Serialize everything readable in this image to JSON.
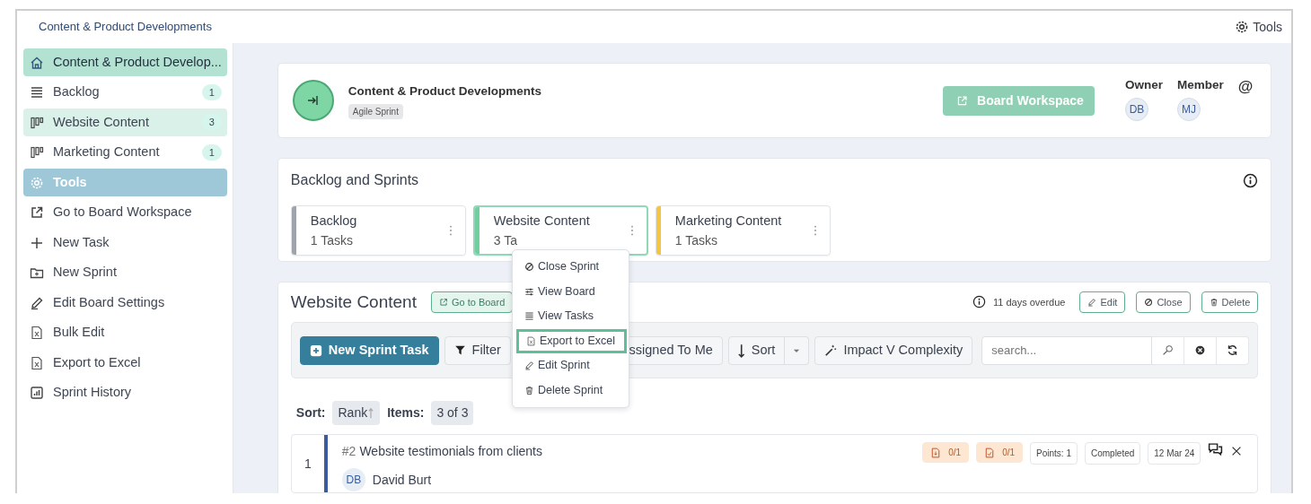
{
  "header": {
    "title": "Content & Product Developments",
    "tools_label": "Tools"
  },
  "sidebar": {
    "items": [
      {
        "kind": "board",
        "label": "Content & Product Develop..."
      },
      {
        "kind": "sprint",
        "label": "Backlog",
        "badge": "1",
        "selected": false
      },
      {
        "kind": "sprint",
        "label": "Website Content",
        "badge": "3",
        "selected": true
      },
      {
        "kind": "sprint",
        "label": "Marketing Content",
        "badge": "1",
        "selected": false
      },
      {
        "kind": "section",
        "label": "Tools"
      },
      {
        "kind": "action",
        "label": "Go to Board Workspace"
      },
      {
        "kind": "action",
        "label": "New Task"
      },
      {
        "kind": "action",
        "label": "New Sprint"
      },
      {
        "kind": "action",
        "label": "Edit Board Settings"
      },
      {
        "kind": "action",
        "label": "Bulk Edit"
      },
      {
        "kind": "action",
        "label": "Export to Excel"
      },
      {
        "kind": "action",
        "label": "Sprint History"
      }
    ]
  },
  "board": {
    "title": "Content & Product Developments",
    "tag": "Agile Sprint",
    "workspace_button": "Board Workspace",
    "roles": [
      {
        "label": "Owner",
        "initials": "DB"
      },
      {
        "label": "Member",
        "initials": "MJ"
      }
    ],
    "mention": "@"
  },
  "sprints": {
    "title": "Backlog and Sprints",
    "cards": [
      {
        "name": "Backlog",
        "count": "1 Tasks",
        "color": "#9ea3ad",
        "selected": false
      },
      {
        "name": "Website Content",
        "count": "3 Ta",
        "color": "#6fcf9f",
        "selected": true
      },
      {
        "name": "Marketing Content",
        "count": "1 Tasks",
        "color": "#f4c542",
        "selected": false
      }
    ]
  },
  "menu": {
    "items": [
      {
        "label": "Close Sprint",
        "selected": false
      },
      {
        "label": "View Board",
        "selected": false
      },
      {
        "label": "View Tasks",
        "selected": false
      },
      {
        "label": "Export to Excel",
        "selected": true
      },
      {
        "label": "Edit Sprint",
        "selected": false
      },
      {
        "label": "Delete Sprint",
        "selected": false
      }
    ]
  },
  "sprint_panel": {
    "title": "Website Content",
    "go_to_board": "Go to Board",
    "overdue": "11 days overdue",
    "actions": [
      {
        "label": "Edit"
      },
      {
        "label": "Close"
      },
      {
        "label": "Delete"
      }
    ],
    "toolbar": {
      "new_task": "New Sprint Task",
      "filter": "Filter",
      "assigned": "ssigned To Me",
      "sort": "Sort",
      "impact": "Impact V Complexity",
      "search_placeholder": "search..."
    },
    "sort_label": "Sort:",
    "sort_value": "Rank",
    "items_label": "Items:",
    "items_value": "3 of 3",
    "tasks": [
      {
        "rank": "1",
        "id": "#2",
        "title": "Website testimonials from clients",
        "initials": "DB",
        "assignee": "David Burt",
        "color": "#3a5c9e",
        "attachments": [
          "0/1",
          "0/1"
        ],
        "points": "Points: 1",
        "status": "Completed",
        "date": "12 Mar 24"
      }
    ]
  }
}
